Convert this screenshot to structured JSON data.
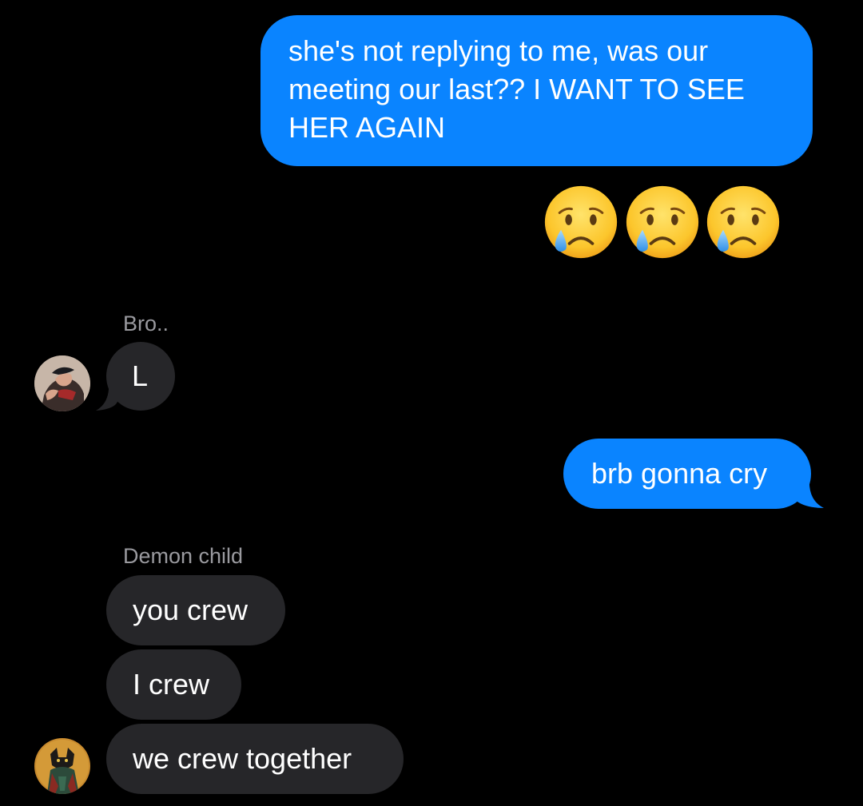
{
  "conversation": {
    "messages": [
      {
        "sender": "me",
        "text": "she's not replying to me, was our meeting our last?? I WANT TO SEE HER AGAIN"
      },
      {
        "sender": "me",
        "emoji": [
          "crying-face",
          "crying-face",
          "crying-face"
        ]
      },
      {
        "sender": "Bro..",
        "text": "L"
      },
      {
        "sender": "me",
        "text": "brb gonna cry"
      },
      {
        "sender": "Demon child",
        "text": "you crew"
      },
      {
        "sender": "Demon child",
        "text": "I crew"
      },
      {
        "sender": "Demon child",
        "text": "we crew together"
      }
    ],
    "senders": {
      "bro": "Bro..",
      "demon": "Demon child"
    }
  },
  "colors": {
    "background": "#000000",
    "sent_bubble": "#0a84ff",
    "received_bubble": "#262629",
    "sender_name": "#9a9a9f"
  }
}
